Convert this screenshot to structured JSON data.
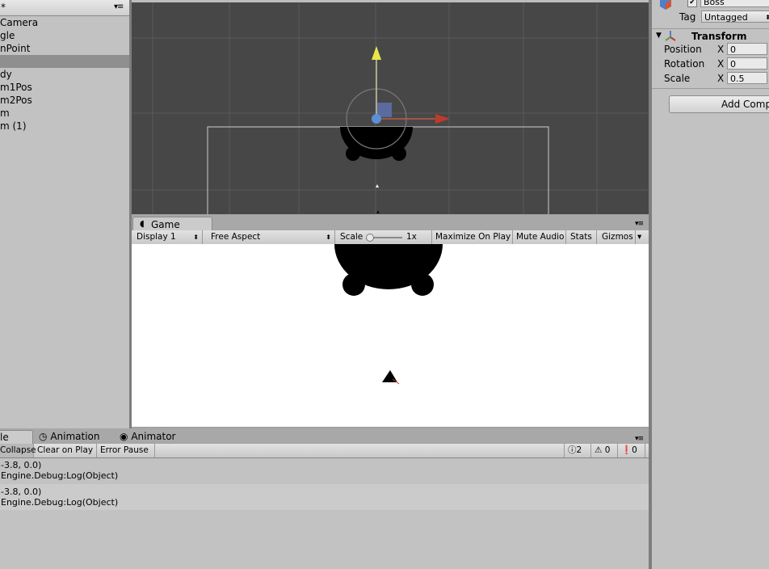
{
  "hierarchy": {
    "header_text": "*",
    "menu_icon": "≡",
    "items": [
      {
        "label": "Camera",
        "selected": false
      },
      {
        "label": "gle",
        "selected": false
      },
      {
        "label": "nPoint",
        "selected": false
      },
      {
        "label": "",
        "selected": true
      },
      {
        "label": "dy",
        "selected": false
      },
      {
        "label": "m1Pos",
        "selected": false
      },
      {
        "label": "m2Pos",
        "selected": false
      },
      {
        "label": "m",
        "selected": false
      },
      {
        "label": "m (1)",
        "selected": false
      }
    ]
  },
  "game": {
    "tab_label": "Game",
    "tab_icon": "pacman-icon",
    "display": "Display 1",
    "aspect": "Free Aspect",
    "scale_label": "Scale",
    "scale_value": "1x",
    "maximize": "Maximize On Play",
    "mute": "Mute Audio",
    "stats": "Stats",
    "gizmos": "Gizmos"
  },
  "console": {
    "tabs": [
      {
        "label": "le",
        "icon": ""
      },
      {
        "label": "Animation",
        "icon": "clock-icon"
      },
      {
        "label": "Animator",
        "icon": "eye-icon"
      }
    ],
    "collapse": "Collapse",
    "clear_on_play": "Clear on Play",
    "error_pause": "Error Pause",
    "log_count": "2",
    "warn_count": "0",
    "error_count": "0",
    "entries": [
      {
        "line1": "-3.8, 0.0)",
        "line2": "Engine.Debug:Log(Object)"
      },
      {
        "line1": "-3.8, 0.0)",
        "line2": "Engine.Debug:Log(Object)"
      }
    ]
  },
  "inspector": {
    "object_name": "Boss",
    "tag_label": "Tag",
    "tag_value": "Untagged",
    "component_title": "Transform",
    "position_label": "Position",
    "rotation_label": "Rotation",
    "scale_label": "Scale",
    "axis_x": "X",
    "position_x": "0",
    "rotation_x": "0",
    "scale_x": "0.5",
    "add_component": "Add Comp"
  },
  "colors": {
    "scene_bg": "#474747",
    "gizmo_y": "#e8e84a",
    "gizmo_x": "#c0392b",
    "gizmo_center": "#5b8fd6",
    "panel_bg": "#c2c2c2"
  }
}
